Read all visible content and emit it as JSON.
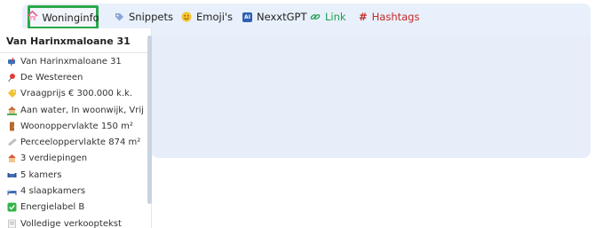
{
  "tabs": [
    {
      "label": "Woninginfo",
      "icon": "house-icon",
      "active": true
    },
    {
      "label": "Snippets",
      "icon": "tag-icon"
    },
    {
      "label": "Emoji's",
      "icon": "smiley-icon"
    },
    {
      "label": "NexxtGPT",
      "icon": "ai-badge-icon",
      "badge": "AI"
    },
    {
      "label": "Link",
      "icon": "link-icon",
      "color": "#1e9e4a"
    },
    {
      "label": "Hashtags",
      "icon": "hash-icon",
      "icon_text": "#",
      "color": "#c62828"
    }
  ],
  "sidebar": {
    "title": "Van Harinxmaloane 31",
    "items": [
      {
        "icon": "mailbox-icon",
        "text": "Van Harinxmaloane 31"
      },
      {
        "icon": "pushpin-icon",
        "text": "De Westereen"
      },
      {
        "icon": "price-tag-icon",
        "text": "Vraagprijs € 300.000 k.k."
      },
      {
        "icon": "house-garden-icon",
        "text": "Aan water, In woonwijk, Vrij uitzicht"
      },
      {
        "icon": "door-icon",
        "text": "Woonoppervlakte 150 m²"
      },
      {
        "icon": "ruler-icon",
        "text": "Perceeloppervlakte 874 m²"
      },
      {
        "icon": "house-icon",
        "text": "3 verdiepingen"
      },
      {
        "icon": "couch-icon",
        "text": "5 kamers"
      },
      {
        "icon": "bed-icon",
        "text": "4 slaapkamers"
      },
      {
        "icon": "check-icon",
        "text": "Energielabel B"
      },
      {
        "icon": "memo-icon",
        "text": "Volledige verkooptekst"
      }
    ]
  }
}
